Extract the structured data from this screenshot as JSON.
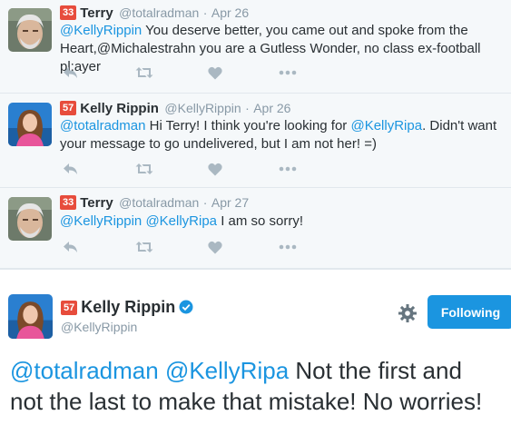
{
  "tweets": [
    {
      "badge": "33",
      "name": "Terry",
      "handle": "@totalradman",
      "sep": "·",
      "time": "Apr 26",
      "mention": "@KellyRippin",
      "text": " You deserve better, you came out and spoke from the Heart,@Michalestrahn you are a Gutless Wonder, no class ex-football pl;ayer"
    },
    {
      "badge": "57",
      "name": "Kelly Rippin",
      "handle": "@KellyRippin",
      "sep": "·",
      "time": "Apr 26",
      "mention1": "@totalradman",
      "text1": " Hi Terry! I think you're looking for ",
      "mention2": "@KellyRipa",
      "text2": ". Didn't want your message to go undelivered, but I am not her! =)"
    },
    {
      "badge": "33",
      "name": "Terry",
      "handle": "@totalradman",
      "sep": "·",
      "time": "Apr 27",
      "mention1": "@KellyRippin",
      "mention2": "@KellyRipa",
      "text": " I am so sorry!"
    }
  ],
  "main_tweet": {
    "badge": "57",
    "name": "Kelly Rippin",
    "handle": "@KellyRippin",
    "follow_label": "Following",
    "mention1": "@totalradman",
    "mention2": "@KellyRipa",
    "text": " Not the first and not the last to make that mistake! No worries!"
  },
  "colors": {
    "link": "#1b95e0",
    "badge": "#e74c3c",
    "muted": "#8899a6",
    "icon": "#aab8c2"
  },
  "icons": [
    "reply-icon",
    "retweet-icon",
    "like-icon",
    "more-icon",
    "gear-icon",
    "verified-icon"
  ]
}
